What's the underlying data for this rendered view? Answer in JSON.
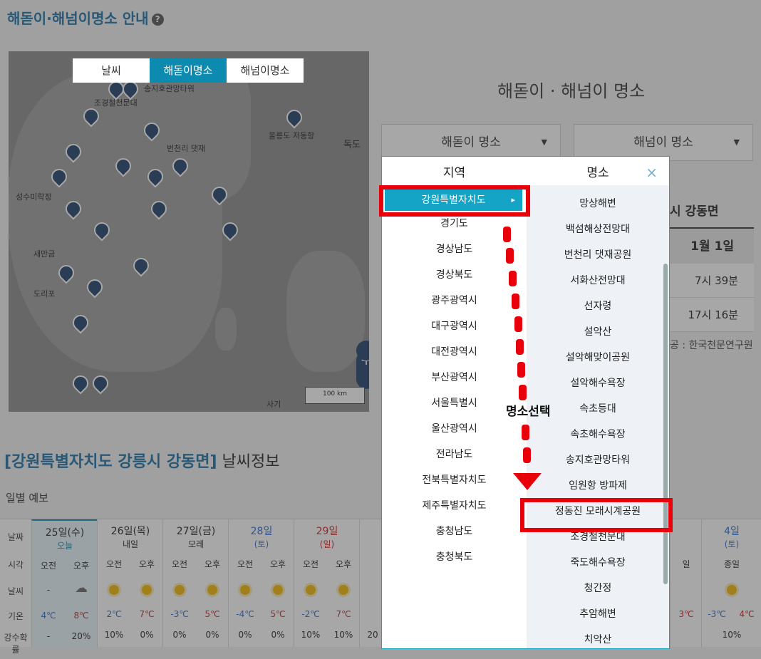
{
  "header": {
    "title": "해돋이·해넘이명소 안내",
    "help": "?"
  },
  "map": {
    "tabs": [
      "날씨",
      "해돋이명소",
      "해넘이명소"
    ],
    "labels": [
      "송지호관망타워",
      "조경철천문대",
      "울릉도 저동항",
      "독도",
      "번천리 댓재",
      "성수미락정",
      "새만금",
      "도리포",
      "사기",
      "100 km"
    ],
    "zoom_in": "+",
    "zoom_out": "−"
  },
  "sunrise": {
    "title": "해돋이 · 해넘이 명소",
    "select_sunrise": "해돋이 명소",
    "select_sunset": "해넘이 명소",
    "arrow": "▼",
    "location": "시 강동면",
    "date": "1월 1일",
    "sunrise_time": "7시 39분",
    "sunset_time": "17시 16분",
    "source": "공 : 한국천문연구원"
  },
  "weather": {
    "title_loc": "[강원특별자치도 강릉시 강동면]",
    "title_rest": " 날씨정보",
    "daily": "일별 예보",
    "row_labels": [
      "날짜",
      "시각",
      "날씨",
      "기온",
      "강수확률"
    ],
    "days": [
      {
        "name": "25일(수)",
        "sub": "오늘",
        "am_temp": "4℃",
        "pm_temp": "8℃",
        "am_rain": "-",
        "pm_rain": "20%",
        "am_w": "-",
        "pm_w": "cloud"
      },
      {
        "name": "26일(목)",
        "sub": "내일",
        "am_temp": "2℃",
        "pm_temp": "7℃",
        "am_rain": "10%",
        "pm_rain": "0%",
        "am_w": "sun",
        "pm_w": "sun"
      },
      {
        "name": "27일(금)",
        "sub": "모레",
        "am_temp": "-3℃",
        "pm_temp": "5℃",
        "am_rain": "0%",
        "pm_rain": "0%",
        "am_w": "sun",
        "pm_w": "sun"
      },
      {
        "name": "28일",
        "sub": "(토)",
        "am_temp": "-4℃",
        "pm_temp": "5℃",
        "am_rain": "0%",
        "pm_rain": "0%",
        "am_w": "sun",
        "pm_w": "sun"
      },
      {
        "name": "29일",
        "sub": "(일)",
        "am_temp": "-2℃",
        "pm_temp": "7℃",
        "am_rain": "10%",
        "pm_rain": "10%",
        "am_w": "sun",
        "pm_w": "sun"
      }
    ],
    "am": "오전",
    "pm": "오후",
    "last_day": {
      "name": "4일",
      "sub": "(토)",
      "period": "종일",
      "am_temp": "-3℃",
      "pm_temp": "4℃",
      "rain": "10%"
    },
    "partial": {
      "period": "일",
      "temp": "3℃",
      "cut": "20"
    }
  },
  "popup": {
    "region_head": "지역",
    "place_head": "명소",
    "close": "×",
    "regions": [
      "강원특별자치도",
      "경기도",
      "경상남도",
      "경상북도",
      "광주광역시",
      "대구광역시",
      "대전광역시",
      "부산광역시",
      "서울특별시",
      "울산광역시",
      "전라남도",
      "전북특별자치도",
      "제주특별자치도",
      "충청남도",
      "충청북도"
    ],
    "places": [
      "망상해변",
      "백섬해상전망대",
      "번천리 댓재공원",
      "서화산전망대",
      "선자령",
      "설악산",
      "설악해맞이공원",
      "설악해수욕장",
      "속초등대",
      "속초해수욕장",
      "송지호관망타워",
      "임원항 방파제",
      "정동진 모래시계공원",
      "조경철천문대",
      "죽도해수욕장",
      "청간정",
      "추암해변",
      "치악산"
    ]
  },
  "annotation": {
    "text": "명소선택"
  }
}
